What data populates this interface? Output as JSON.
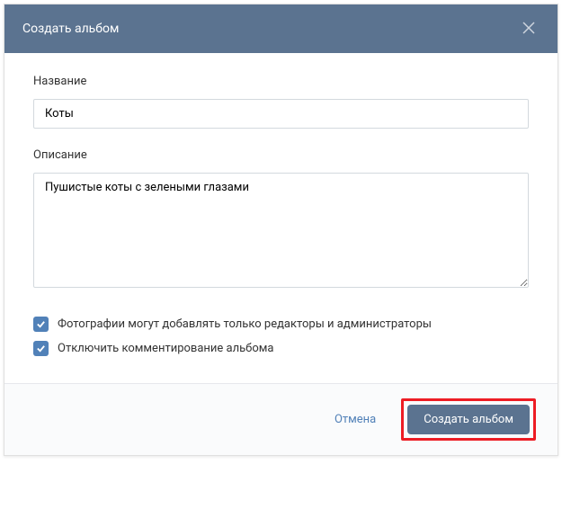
{
  "modal": {
    "title": "Создать альбом",
    "name_label": "Название",
    "name_value": "Коты",
    "description_label": "Описание",
    "description_value": "Пушистые коты с зелеными глазами",
    "checkbox_editors_label": "Фотографии могут добавлять только редакторы и администраторы",
    "checkbox_editors_checked": true,
    "checkbox_comments_label": "Отключить комментирование альбома",
    "checkbox_comments_checked": true,
    "cancel_label": "Отмена",
    "submit_label": "Создать альбом"
  }
}
